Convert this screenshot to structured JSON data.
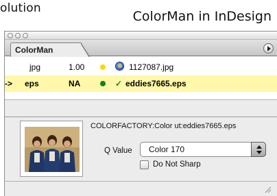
{
  "captions": {
    "left": "olution",
    "right": "ColorMan in InDesign"
  },
  "palette": {
    "tab_label": "ColorMan",
    "rows": [
      {
        "arrow": "",
        "type": "jpg",
        "value": "1.00",
        "status_color": "#ffd800",
        "icon": "globe-icon",
        "filename": "1127087.jpg",
        "selected": false
      },
      {
        "arrow": "->",
        "type": "eps",
        "value": "NA",
        "status_color": "#1a7f1a",
        "icon": "check-icon",
        "check": "✓",
        "filename": "eddies7665.eps",
        "selected": true
      }
    ],
    "detail": {
      "filepath": "COLORFACTORY:Color ut:eddies7665.eps",
      "q_label": "Q Value",
      "q_selected": "Color 170",
      "checkbox_label": "Do Not Sharp",
      "checkbox_checked": false
    }
  },
  "colors": {
    "selected_row": "#fff8a8",
    "panel_bg": "#ececec"
  }
}
